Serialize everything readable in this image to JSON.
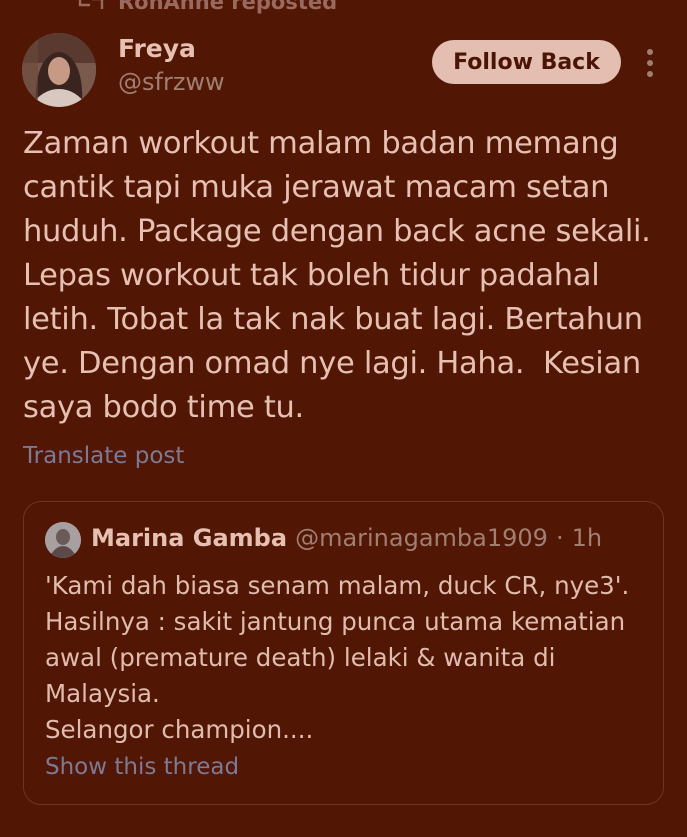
{
  "repost": {
    "label": "RohAnne reposted",
    "icon": "repost-icon"
  },
  "author": {
    "name": "Freya",
    "handle": "@sfrzww",
    "avatar_icon": "user-avatar"
  },
  "follow_button": {
    "label": "Follow Back",
    "bg_color": "#e4bfb1",
    "text_color": "#4a1506"
  },
  "more_icon": "more-vertical-icon",
  "post": {
    "text": "Zaman workout malam badan memang cantik tapi muka jerawat macam setan huduh. Package dengan back acne sekali. Lepas workout tak boleh tidur padahal letih. Tobat la tak nak buat lagi. Bertahun ye. Dengan omad nye lagi. Haha.  Kesian saya bodo time tu.",
    "translate_label": "Translate post"
  },
  "quote": {
    "name": "Marina Gamba",
    "handle": "@marinagamba1909",
    "separator": "·",
    "time": "1h",
    "text": "'Kami dah biasa senam malam, duck CR, nye3'.\nHasilnya : sakit jantung punca utama kematian awal (premature death) lelaki & wanita di Malaysia.\nSelangor champion....",
    "link_label": "Show this thread"
  },
  "colors": {
    "background": "#511604",
    "primary_text": "#e6c0b2",
    "secondary_text": "#a07e72",
    "link": "#7d7a94",
    "border": "#6e3424"
  }
}
